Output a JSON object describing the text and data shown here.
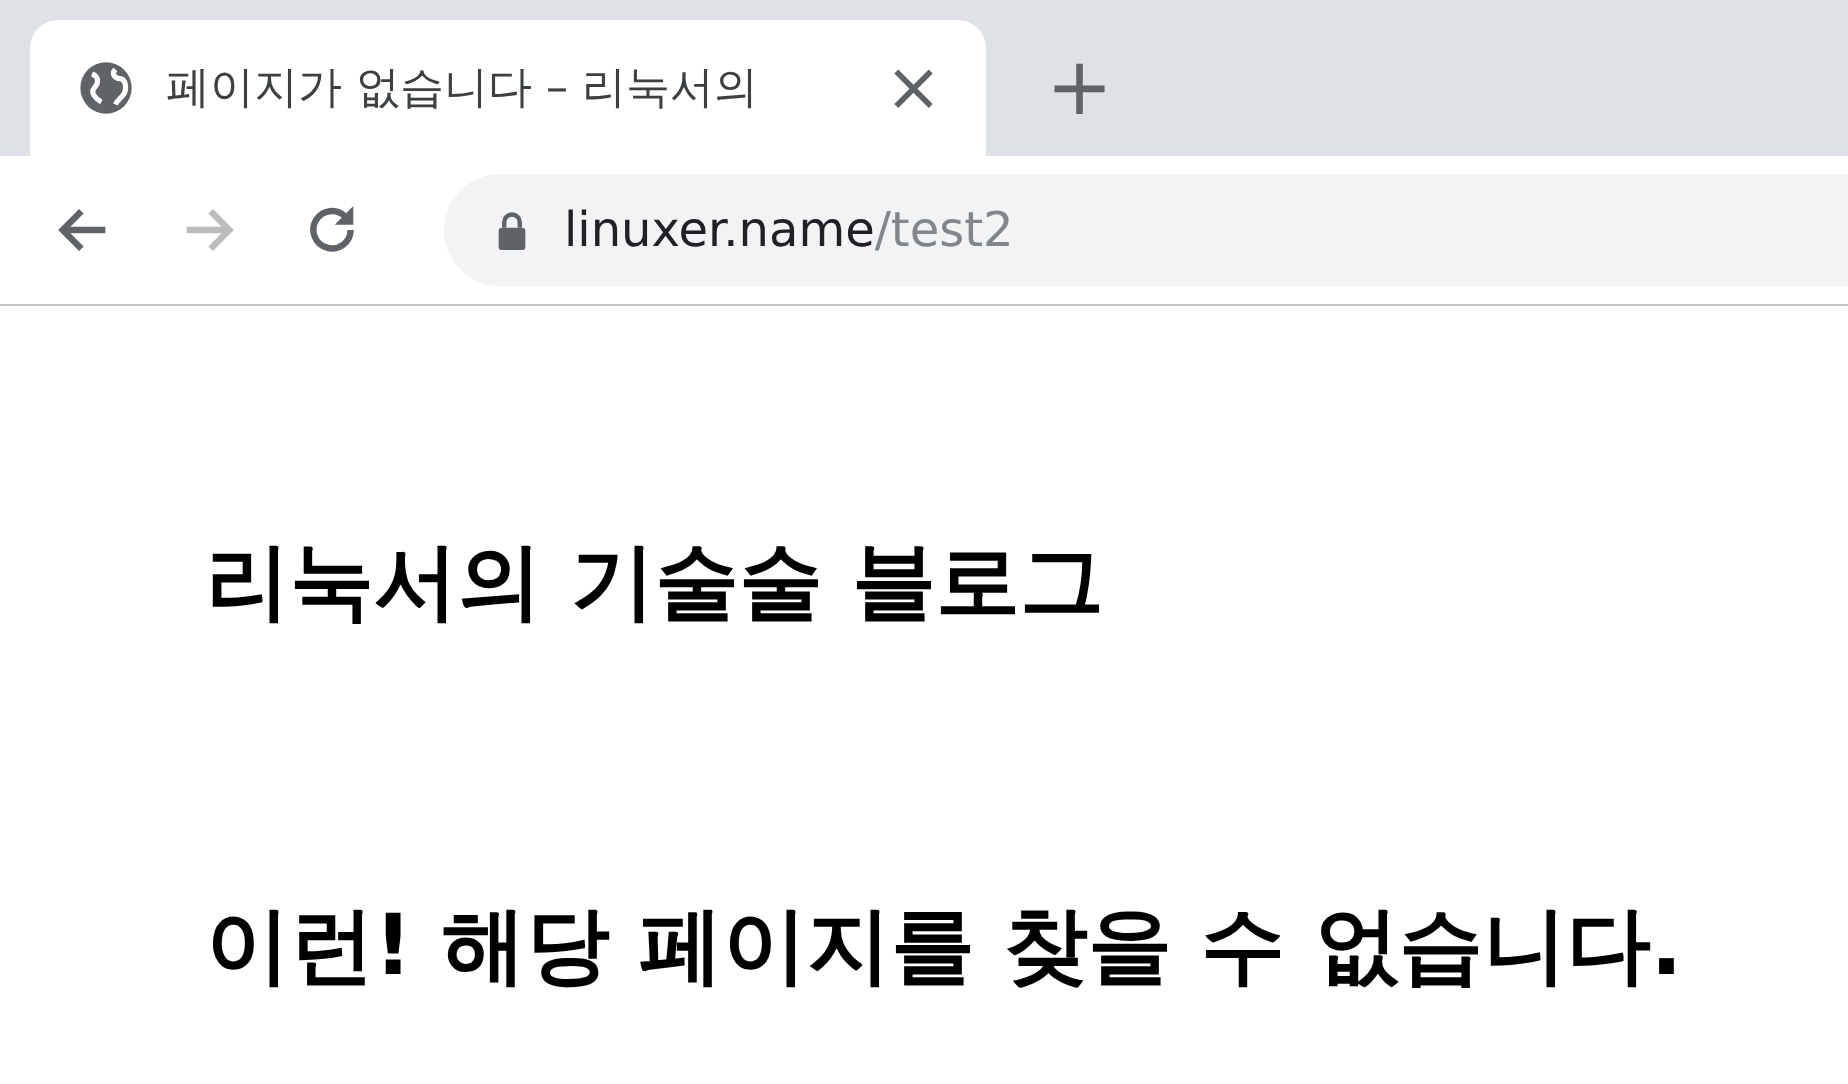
{
  "tab": {
    "title": "페이지가 없습니다 – 리눅서의",
    "close": "×"
  },
  "new_tab": "+",
  "address": {
    "host": "linuxer.name",
    "path": "/test2"
  },
  "nav": {
    "back_disabled": false,
    "forward_disabled": true
  },
  "page": {
    "blog_title": "리눅서의 기술술 블로그",
    "message": "이런! 해당 페이지를 찾을 수 없습니다."
  }
}
